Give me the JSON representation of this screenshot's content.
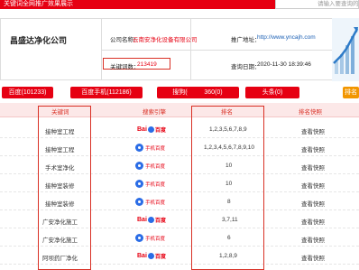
{
  "topbar": {
    "title": "关键词全网推广效果展示",
    "search_placeholder": "请输入要查询的"
  },
  "company": {
    "name": "昌盛达净化公司",
    "company_label": "公司名称：",
    "company_value": "云南安净化设备有限公司",
    "site_label": "推广地址：",
    "site_value": "http://www.yncajh.com",
    "kw_count_label": "关键词数：",
    "kw_count_value": "213419",
    "query_time_label": "查询日期：",
    "query_time_value": "2020-11-30 18:39:46"
  },
  "tabs": [
    {
      "label": "百度(101233)"
    },
    {
      "label": "百度手机(112186)"
    },
    {
      "label": "搜狗(0)"
    },
    {
      "label": "360(0)"
    },
    {
      "label": "头条(0)"
    },
    {
      "label": "排名"
    }
  ],
  "table": {
    "headers": [
      "关键词",
      "搜索引擎",
      "排名",
      "排名快照"
    ],
    "rows": [
      {
        "keyword": "接种室工程",
        "engine": "baidu",
        "rank": "1,2,3,5,6,7,8,9",
        "snapshot": "查看快照"
      },
      {
        "keyword": "接种室工程",
        "engine": "baidu-mobile",
        "rank": "1,2,3,4,5,6,7,8,9,10",
        "snapshot": "查看快照"
      },
      {
        "keyword": "手术室净化",
        "engine": "baidu-mobile",
        "rank": "10",
        "snapshot": "查看快照"
      },
      {
        "keyword": "接种室装修",
        "engine": "baidu-mobile",
        "rank": "10",
        "snapshot": "查看快照"
      },
      {
        "keyword": "接种室装修",
        "engine": "baidu-mobile",
        "rank": "8",
        "snapshot": "查看快照"
      },
      {
        "keyword": "广安净化施工",
        "engine": "baidu",
        "rank": "3,7,11",
        "snapshot": "查看快照"
      },
      {
        "keyword": "广安净化施工",
        "engine": "baidu-mobile",
        "rank": "6",
        "snapshot": "查看快照"
      },
      {
        "keyword": "阿坝药厂净化",
        "engine": "baidu",
        "rank": "1,2,8,9",
        "snapshot": "查看快照"
      }
    ]
  },
  "engine_labels": {
    "baidu_bd": "Bai",
    "baidu_cn": "百度",
    "mobile": "手机百度"
  },
  "colors": {
    "primary": "#e60012",
    "accent": "#f29600",
    "link": "#1a5fb4",
    "header_bg": "#fce8e8"
  }
}
